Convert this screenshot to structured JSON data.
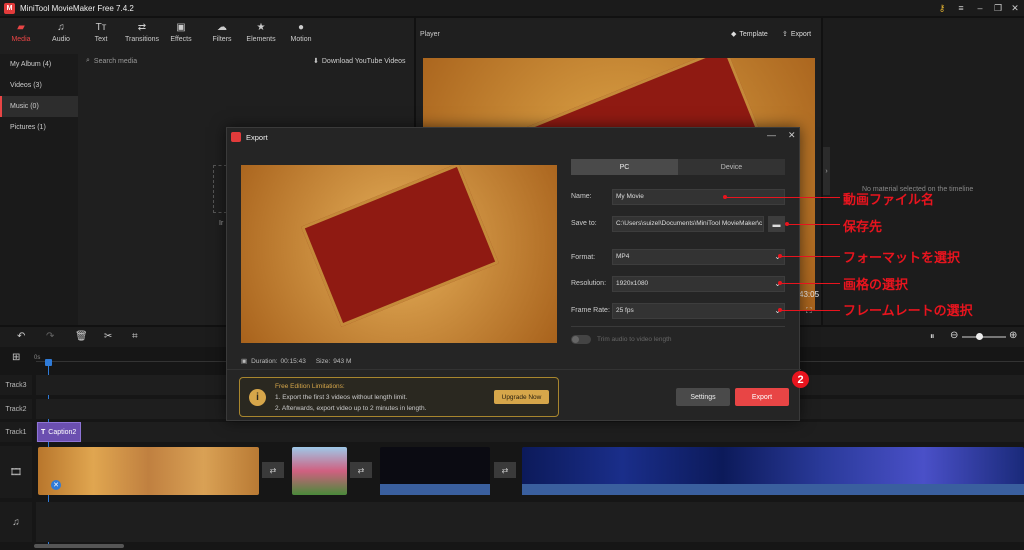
{
  "app": {
    "title": "MiniTool MovieMaker Free 7.4.2",
    "logo": "M"
  },
  "toolbar": {
    "items": [
      {
        "label": "Media",
        "icon": "folder-icon"
      },
      {
        "label": "Audio",
        "icon": "music-note-icon"
      },
      {
        "label": "Text",
        "icon": "text-icon"
      },
      {
        "label": "Transitions",
        "icon": "transitions-icon"
      },
      {
        "label": "Effects",
        "icon": "effects-icon"
      },
      {
        "label": "Filters",
        "icon": "filters-icon"
      },
      {
        "label": "Elements",
        "icon": "elements-icon"
      },
      {
        "label": "Motion",
        "icon": "motion-icon"
      }
    ],
    "active": "Media"
  },
  "sidebar": {
    "items": [
      {
        "label": "My Album (4)"
      },
      {
        "label": "Videos (3)"
      },
      {
        "label": "Music (0)"
      },
      {
        "label": "Pictures (1)"
      }
    ],
    "active": "Music (0)"
  },
  "media": {
    "search_placeholder": "Search media",
    "download_label": "Download YouTube Videos",
    "import_partial": "Ir"
  },
  "player": {
    "label": "Player",
    "template_label": "Template",
    "export_label": "Export",
    "time_partial": "43:05"
  },
  "properties": {
    "empty_text": "No material selected on the timeline"
  },
  "timeline": {
    "ruler_start": "0s",
    "tracks": [
      "Track3",
      "Track2",
      "Track1"
    ],
    "caption_clip": "Caption2"
  },
  "export_dialog": {
    "title": "Export",
    "tabs": [
      "PC",
      "Device"
    ],
    "active_tab": "PC",
    "fields": {
      "name": {
        "label": "Name:",
        "value": "My Movie"
      },
      "save_to": {
        "label": "Save to:",
        "value": "C:\\Users\\suizel\\Documents\\MiniTool MovieMaker\\c"
      },
      "format": {
        "label": "Format:",
        "value": "MP4"
      },
      "resolution": {
        "label": "Resolution:",
        "value": "1920x1080"
      },
      "frame_rate": {
        "label": "Frame Rate:",
        "value": "25 fps"
      }
    },
    "trim_label": "Trim audio to video length",
    "duration_label": "Duration:",
    "duration_value": "00:15:43",
    "size_label": "Size:",
    "size_value": "943 M",
    "limitations": {
      "title": "Free Edition Limitations:",
      "line1": "1. Export the first 3 videos without length limit.",
      "line2": "2. Afterwards, export video up to 2 minutes in length.",
      "upgrade_label": "Upgrade Now"
    },
    "settings_label": "Settings",
    "export_label": "Export"
  },
  "annotations": {
    "name": "動画ファイル名",
    "save_to": "保存先",
    "format": "フォーマットを選択",
    "resolution": "画格の選択",
    "frame_rate": "フレームレートの選択",
    "step": "2"
  },
  "colors": {
    "accent": "#e84545",
    "annotation": "#e8141e",
    "upgrade": "#d6a64a"
  }
}
